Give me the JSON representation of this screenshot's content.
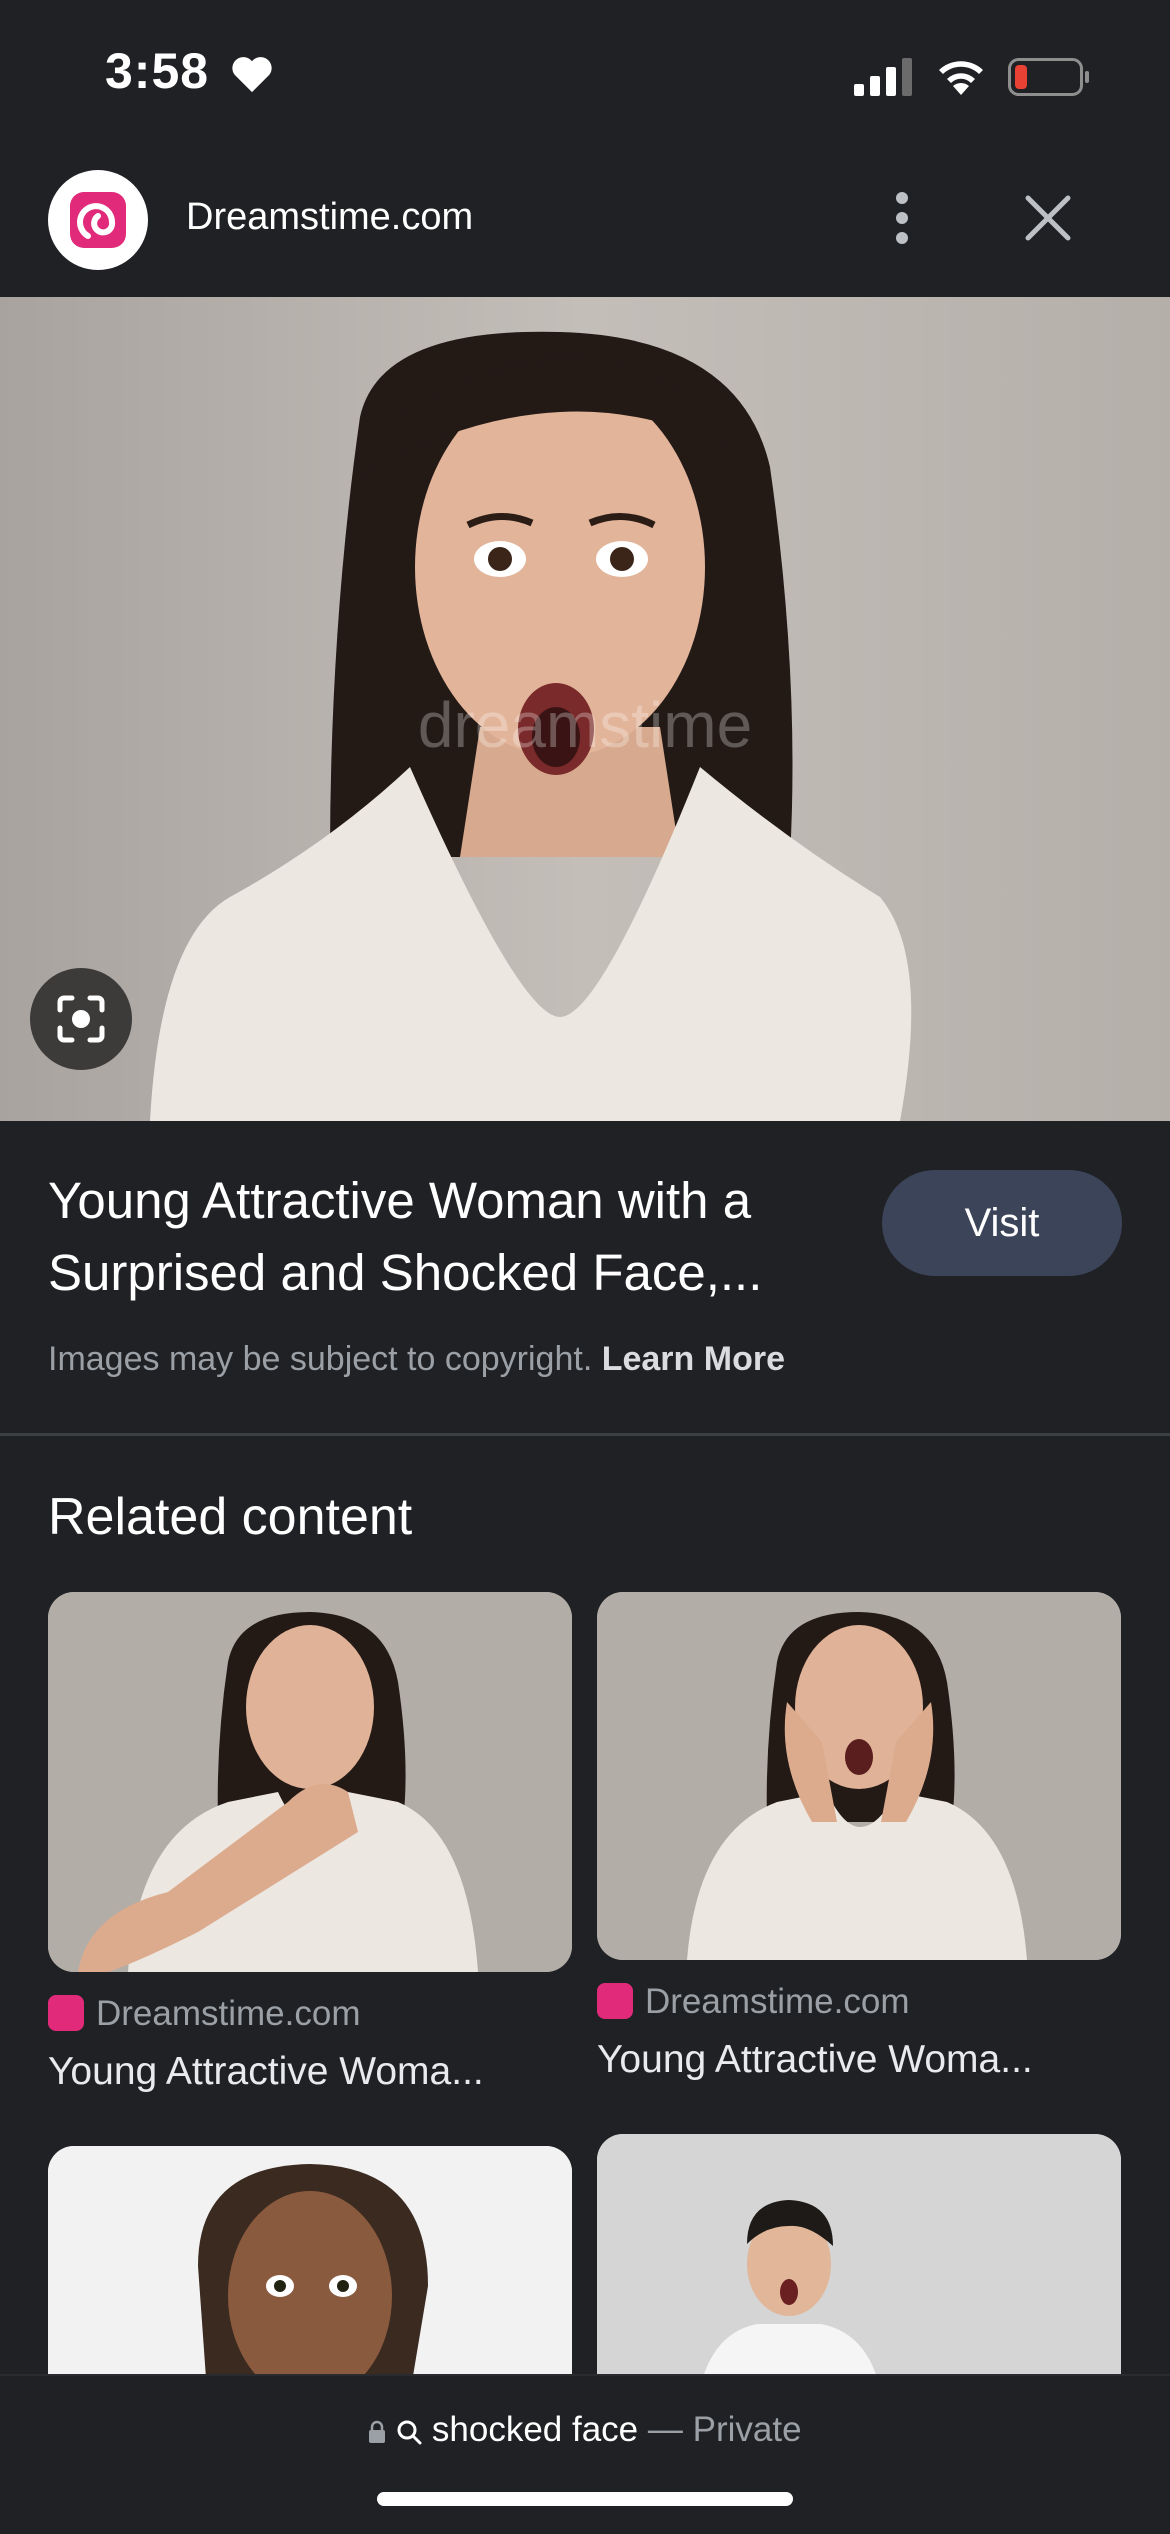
{
  "status_bar": {
    "time": "3:58"
  },
  "header": {
    "site_name": "Dreamstime.com"
  },
  "result": {
    "title": "Young Attractive Woman with a Surprised and Shocked Face,...",
    "visit_label": "Visit",
    "copyright_text": "Images may be subject to copyright.",
    "learn_more": "Learn More",
    "watermark": "dreamstime"
  },
  "related": {
    "heading": "Related content",
    "cards": [
      {
        "source": "Dreamstime.com",
        "title": "Young Attractive Woma..."
      },
      {
        "source": "Dreamstime.com",
        "title": "Young Attractive Woma..."
      }
    ]
  },
  "bottom_bar": {
    "query": "shocked face",
    "separator": "—",
    "mode": "Private"
  },
  "colors": {
    "background": "#202124",
    "visit_button": "#3c4459",
    "brand": "#e22a7a"
  },
  "icons": [
    "heart-icon",
    "signal-icon",
    "wifi-icon",
    "battery-icon",
    "dreamstime-logo-icon",
    "more-vert-icon",
    "close-icon",
    "lens-icon",
    "lock-icon",
    "search-icon"
  ]
}
